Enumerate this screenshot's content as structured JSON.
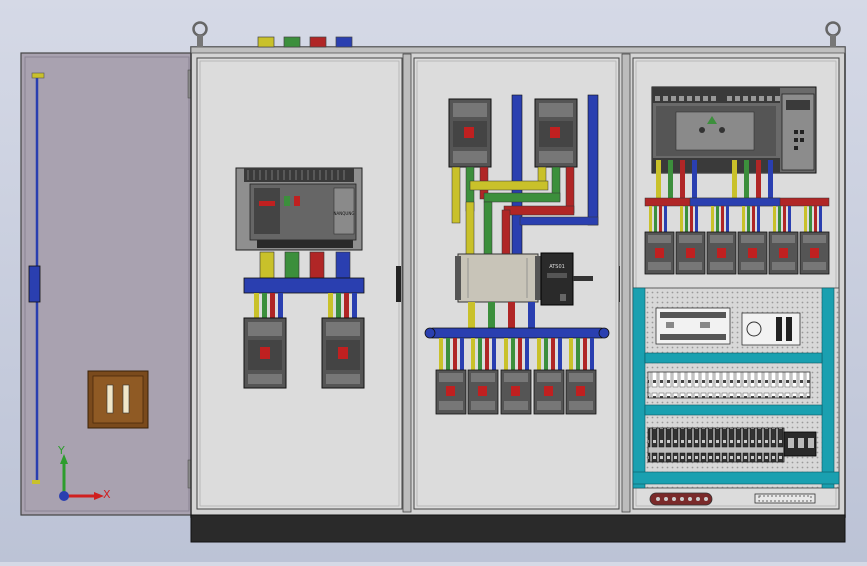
{
  "scene": {
    "type": "3d-cad-electrical-cabinet",
    "door_state": "left door open",
    "sections": [
      "incoming-breaker-section",
      "busbar-distribution-section",
      "plc-control-section"
    ]
  },
  "colors": {
    "background_top": "#d5d9e6",
    "background_bottom": "#bcc3d6",
    "cabinet_body": "#d4d4d4",
    "door_panel": "#a9a2b0",
    "plinth": "#2a2a2a",
    "phase_yellow": "#c9c12a",
    "phase_green": "#3c8f3c",
    "phase_red": "#b02626",
    "neutral_blue": "#2a3fb0",
    "din_rail_teal": "#1aa0b0",
    "handle_brown": "#7a4a1c"
  },
  "labels": {
    "acb_brand": "NANQUNG",
    "ats_text": "ATS01",
    "axis_y": "Y",
    "axis_x": "X"
  },
  "counts": {
    "section2_outgoing_breakers": 5,
    "section3_mcbs": 6,
    "terminal_rows": 2
  }
}
